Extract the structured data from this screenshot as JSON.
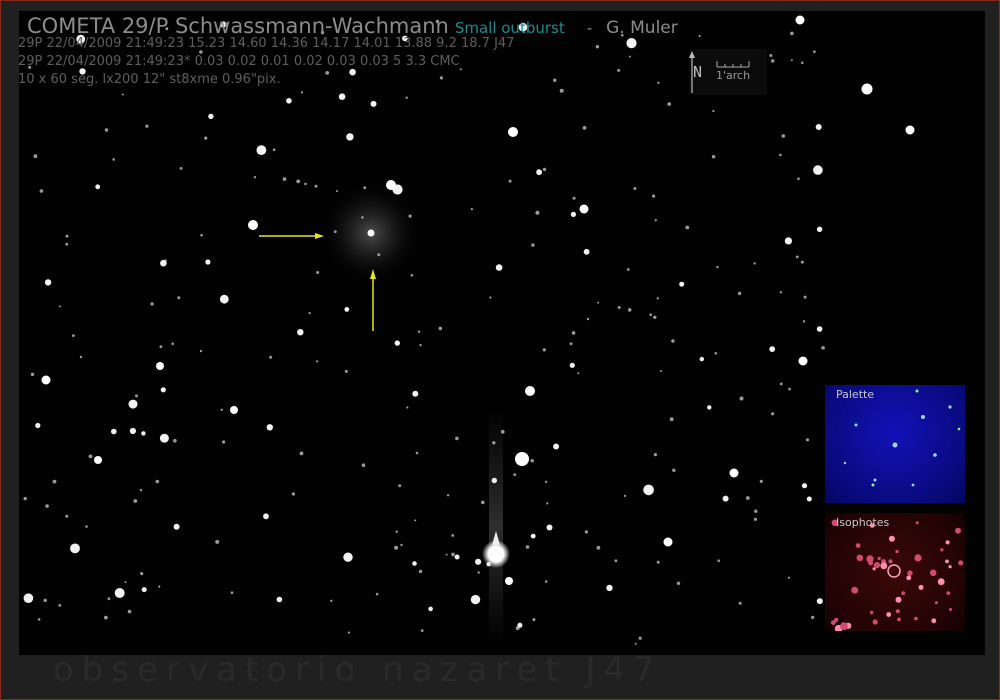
{
  "title": {
    "main": "COMETA 29/P Schwassmann-Wachmann",
    "note": "Small outburst",
    "separator": "-",
    "author": "G. Muler"
  },
  "meta": {
    "line1": "29P 22/04/2009 21:49:23 15.23 14.60 14.36 14.17 14.01 13.88 9.2 18.7 J47",
    "line2": "29P 22/04/2009 21:49:23* 0.03 0.02 0.01 0.02 0.03 0.03 5 3.3 CMC",
    "line3": "10 x 60 seg. lx200 12\" st8xme 0.96\"pix."
  },
  "compass": {
    "north": "N",
    "scale": "1'arch"
  },
  "insets": {
    "palette": "Palette",
    "isophotes": "Isophotes"
  },
  "watermark": "observatorio nazaret J47",
  "colors": {
    "arrow": "#e6e620",
    "note": "#1f8a8a",
    "palette_bg": "#1212b8",
    "isophote_bg": "#3a0808"
  }
}
